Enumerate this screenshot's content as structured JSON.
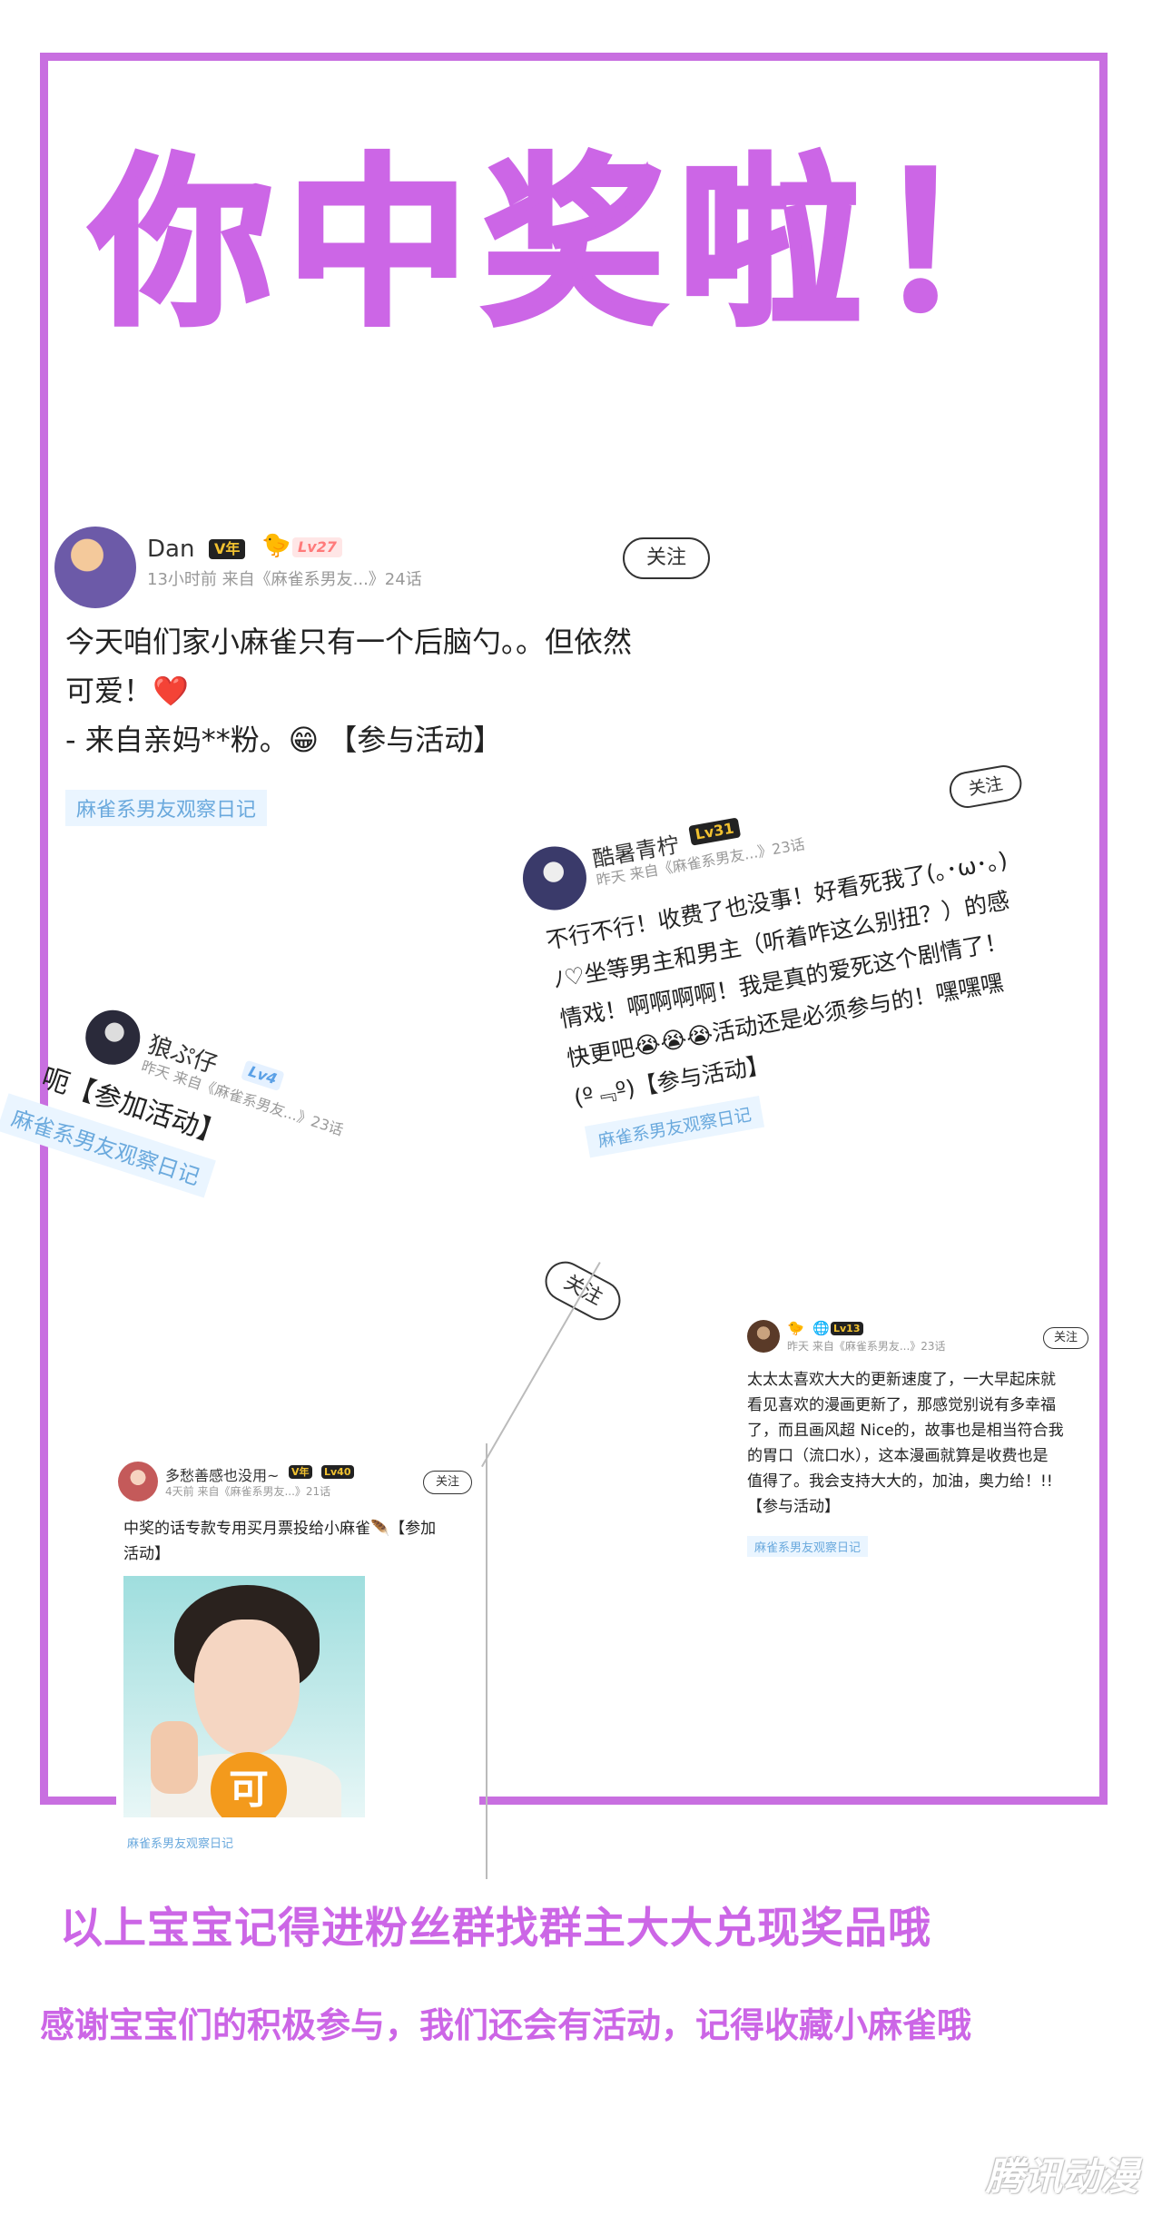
{
  "headline": "你中奖啦！",
  "posts": [
    {
      "username": "Dan",
      "vip_badge": "V年",
      "level": "Lv27",
      "meta": "13小时前  来自《麻雀系男友...》24话",
      "follow_label": "关注",
      "lines": [
        "今天咱们家小麻雀只有一个后脑勺。。但依然",
        "可爱！❤️",
        "- 来自亲妈**粉。😁 【参与活动】"
      ],
      "tag": "麻雀系男友观察日记"
    },
    {
      "username": "酷暑青柠",
      "level": "Lv31",
      "meta": "昨天  来自《麻雀系男友...》23话",
      "follow_label": "关注",
      "lines": [
        "不行不行！收费了也没事！好看死我了(｡･ω･｡)",
        "ﾉ♡坐等男主和男主（听着咋这么别扭？）的感",
        "情戏！啊啊啊啊！我是真的爱死这个剧情了！",
        "快更吧😭😭😭活动还是必须参与的！嘿嘿嘿",
        "(º﹃º)【参与活动】"
      ],
      "tag": "麻雀系男友观察日记"
    },
    {
      "username": "狼ぷ仔",
      "level": "Lv4",
      "meta": "昨天  来自《麻雀系男友...》23话",
      "lines": [
        "呃【参加活动】"
      ],
      "tag": "麻雀系男友观察日记"
    },
    {
      "follow_label": "关注"
    },
    {
      "level": "Lv13",
      "meta": "昨天  来自《麻雀系男友...》23话",
      "follow_label": "关注",
      "lines": [
        "太太太喜欢大大的更新速度了，一大早起床就",
        "看见喜欢的漫画更新了，那感觉别说有多幸福",
        "了，而且画风超 Nice的，故事也是相当符合我",
        "的胃口（流口水），这本漫画就算是收费也是",
        "值得了。我会支持大大的，加油，奥力给！!!",
        "【参与活动】"
      ],
      "tag": "麻雀系男友观察日记"
    },
    {
      "username": "多愁善感也没用~",
      "vip_badge": "V年",
      "level": "Lv40",
      "meta": "4天前  来自《麻雀系男友...》21话",
      "follow_label": "关注",
      "lines": [
        "中奖的话专款专用买月票投给小麻雀🪶【参加",
        "活动】"
      ],
      "image_badge": "可",
      "tag": "麻雀系男友观察日记"
    }
  ],
  "footer_line1": "以上宝宝记得进粉丝群找群主大大兑现奖品哦",
  "footer_line2": "感谢宝宝们的积极参与，我们还会有活动，记得收藏小麻雀哦",
  "watermark": "腾讯动漫",
  "colors": {
    "accent": "#cc66e6",
    "tag_bg": "#eaf5ff",
    "tag_text": "#6aa9dd"
  }
}
